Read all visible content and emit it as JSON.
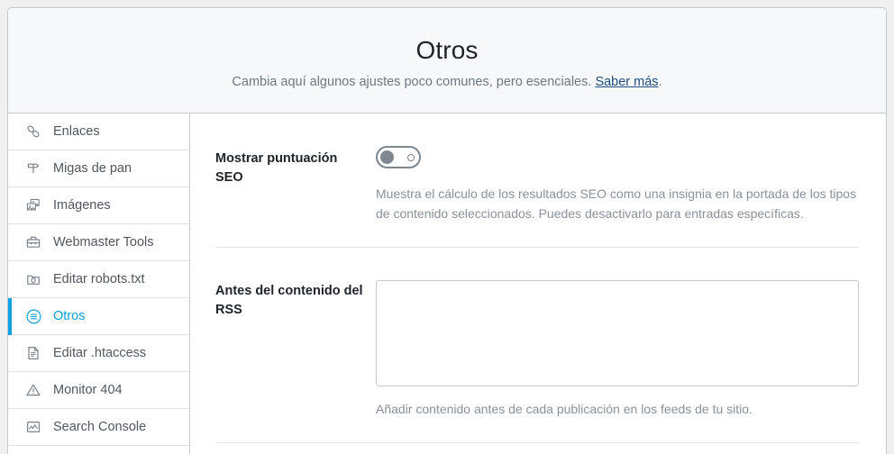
{
  "header": {
    "title": "Otros",
    "subtitle_before": "Cambia aquí algunos ajustes poco comunes, pero esenciales. ",
    "link_label": "Saber más",
    "subtitle_after": "."
  },
  "sidebar": {
    "items": [
      {
        "label": "Enlaces",
        "icon": "link-icon",
        "active": false
      },
      {
        "label": "Migas de pan",
        "icon": "breadcrumb-icon",
        "active": false
      },
      {
        "label": "Imágenes",
        "icon": "images-icon",
        "active": false
      },
      {
        "label": "Webmaster Tools",
        "icon": "toolbox-icon",
        "active": false
      },
      {
        "label": "Editar robots.txt",
        "icon": "robots-file-icon",
        "active": false
      },
      {
        "label": "Otros",
        "icon": "list-circle-icon",
        "active": true
      },
      {
        "label": "Editar .htaccess",
        "icon": "document-icon",
        "active": false
      },
      {
        "label": "Monitor 404",
        "icon": "warning-triangle-icon",
        "active": false
      },
      {
        "label": "Search Console",
        "icon": "chart-icon",
        "active": false
      }
    ]
  },
  "main": {
    "settings": [
      {
        "label": "Mostrar puntuación SEO",
        "control": "toggle",
        "toggle_state": "off",
        "help": "Muestra el cálculo de los resultados SEO como una insignia en la portada de los tipos de contenido seleccionados. Puedes desactivarlo para entradas específicas."
      },
      {
        "label": "Antes del contenido del RSS",
        "control": "textarea",
        "value": "",
        "placeholder": "",
        "help": "Añadir contenido antes de cada publicación en los feeds de tu sitio."
      }
    ]
  },
  "colors": {
    "accent": "#0ba1e0",
    "link": "#1c4c7c",
    "border": "#c3c9d2",
    "muted_text": "#8a9199",
    "toggle_off": "#7e868f"
  }
}
